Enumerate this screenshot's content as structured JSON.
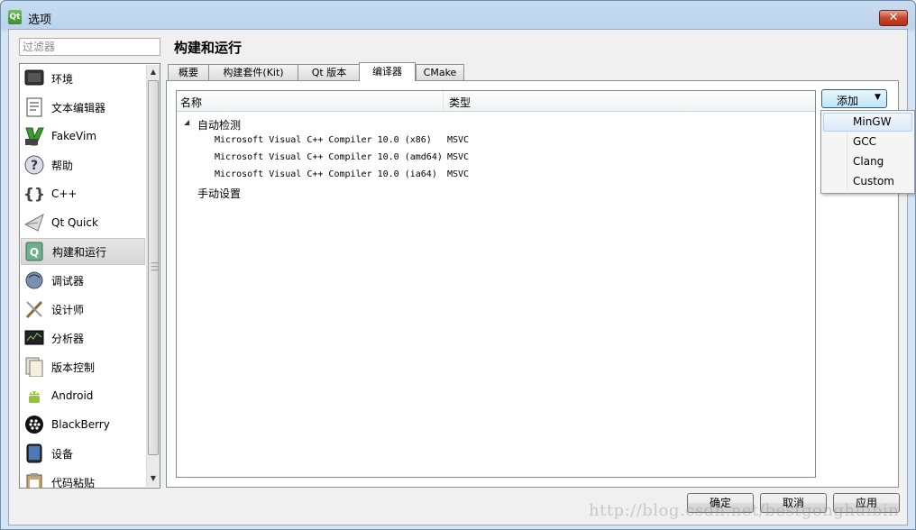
{
  "window": {
    "title": "选项",
    "app_icon": "qt-icon",
    "close_glyph": "✕"
  },
  "sidebar": {
    "filter_placeholder": "过滤器",
    "selected": "构建和运行",
    "items": [
      {
        "label": "环境",
        "icon": "monitor-icon"
      },
      {
        "label": "文本编辑器",
        "icon": "text-document-icon"
      },
      {
        "label": "FakeVim",
        "icon": "fakevim-icon"
      },
      {
        "label": "帮助",
        "icon": "question-mark-icon"
      },
      {
        "label": "C++",
        "icon": "braces-icon"
      },
      {
        "label": "Qt Quick",
        "icon": "paper-plane-icon"
      },
      {
        "label": "构建和运行",
        "icon": "build-run-icon"
      },
      {
        "label": "调试器",
        "icon": "debugger-icon"
      },
      {
        "label": "设计师",
        "icon": "designer-brush-icon"
      },
      {
        "label": "分析器",
        "icon": "analyzer-icon"
      },
      {
        "label": "版本控制",
        "icon": "version-control-icon"
      },
      {
        "label": "Android",
        "icon": "android-icon"
      },
      {
        "label": "BlackBerry",
        "icon": "blackberry-icon"
      },
      {
        "label": "设备",
        "icon": "device-icon"
      },
      {
        "label": "代码粘贴",
        "icon": "clipboard-icon"
      }
    ]
  },
  "main": {
    "title": "构建和运行",
    "active_tab": "编译器",
    "tabs": [
      {
        "label": "概要"
      },
      {
        "label": "构建套件(Kit)"
      },
      {
        "label": "Qt 版本"
      },
      {
        "label": "编译器"
      },
      {
        "label": "CMake"
      }
    ],
    "compiler_table": {
      "columns": [
        "名称",
        "类型"
      ],
      "groups": [
        {
          "label": "自动检测",
          "expander": "◢",
          "rows": [
            {
              "name": "Microsoft Visual C++ Compiler 10.0 (x86)",
              "type": "MSVC"
            },
            {
              "name": "Microsoft Visual C++ Compiler 10.0 (amd64)",
              "type": "MSVC"
            },
            {
              "name": "Microsoft Visual C++ Compiler 10.0 (ia64)",
              "type": "MSVC"
            }
          ]
        },
        {
          "label": "手动设置",
          "rows": []
        }
      ]
    },
    "add_button": {
      "label": "添加",
      "arrow": "▼",
      "menu": [
        {
          "label": "MinGW",
          "highlighted": true
        },
        {
          "label": "GCC"
        },
        {
          "label": "Clang"
        },
        {
          "label": "Custom"
        }
      ]
    }
  },
  "footer": {
    "ok": "确定",
    "cancel": "取消",
    "apply": "应用"
  },
  "watermark": "http://blog.csdn.net/bestgonghuibin",
  "colors": {
    "titlebar": "#bcd3ec",
    "close_button": "#c7452d",
    "selection": "#d6d6d6",
    "menu_highlight": "#dbe9f8"
  }
}
